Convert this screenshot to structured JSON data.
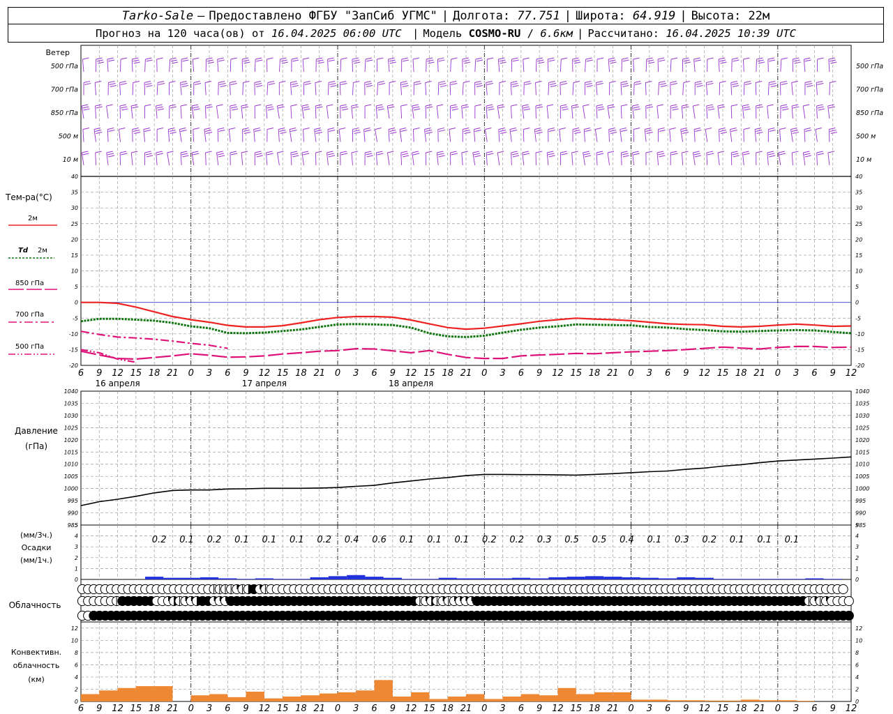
{
  "header": {
    "station": "Tarko-Sale",
    "provider": "Предоставлено ФГБУ \"ЗапСиб УГМС\"",
    "lon_label": "Долгота:",
    "lon": "77.751",
    "lat_label": "Широта:",
    "lat": "64.919",
    "alt_label": "Высота:",
    "alt": "22м",
    "forecast_label": "Прогноз на 120 часа(ов) от",
    "forecast_time": "16.04.2025 06:00 UTC",
    "model_label": "Модель",
    "model": "COSMO-RU",
    "resolution": "6.6км",
    "calc_label": "Рассчитано:",
    "calc_time": "16.04.2025 10:39 UTC"
  },
  "labels": {
    "wind": "Ветер",
    "temp": "Тем-ра(°С)",
    "t2m": "2м",
    "td": "Td",
    "td_level": "2м",
    "t850": "850 гПа",
    "t700": "700 гПа",
    "t500": "500 гПа",
    "pressure1": "Давление",
    "pressure2": "(гПа)",
    "precip1": "(мм/3ч.)",
    "precip2": "Осадки",
    "precip3": "(мм/1ч.)",
    "clouds": "Облачность",
    "conv1": "Конвективн.",
    "conv2": "облачность",
    "conv3": "(км)"
  },
  "chart_data": [
    {
      "type": "wind-barbs",
      "levels": [
        "500 гПа",
        "700 гПа",
        "850 гПа",
        "500 м",
        "10 м"
      ],
      "x_range_hours": [
        0,
        126
      ],
      "color": "#9933cc"
    },
    {
      "type": "line",
      "ylabel": "Тем-ра(°С)",
      "ylim": [
        -20,
        40
      ],
      "yticks": [
        -20,
        -15,
        -10,
        -5,
        0,
        5,
        10,
        15,
        20,
        25,
        30,
        35,
        40
      ],
      "x_hours": [
        0,
        3,
        6,
        9,
        12,
        15,
        18,
        21,
        24,
        27,
        30,
        33,
        36,
        39,
        42,
        45,
        48,
        51,
        54,
        57,
        60,
        63,
        66,
        69,
        72,
        75,
        78,
        81,
        84,
        87,
        90,
        93,
        96,
        99,
        102,
        105,
        108,
        111,
        114,
        117,
        120,
        123,
        126
      ],
      "xtick_labels": [
        "6",
        "9",
        "12",
        "15",
        "18",
        "21",
        "0",
        "3",
        "6",
        "9",
        "12",
        "15",
        "18",
        "21",
        "0",
        "3",
        "6",
        "9",
        "12",
        "15",
        "18",
        "21",
        "0",
        "3",
        "6",
        "9",
        "12",
        "15",
        "18",
        "21",
        "0",
        "3",
        "6",
        "9",
        "12",
        "15",
        "18",
        "21",
        "0",
        "3",
        "6",
        "9",
        "12"
      ],
      "day_labels": [
        {
          "hour": 6,
          "text": "16 апреля"
        },
        {
          "hour": 30,
          "text": "17 апреля"
        },
        {
          "hour": 54,
          "text": "18 апреля"
        }
      ],
      "series": [
        {
          "name": "2м",
          "color": "#ee2222",
          "dash": "solid",
          "x": [
            0,
            3,
            6,
            9,
            12,
            15,
            18,
            21,
            24,
            27,
            30,
            33,
            36,
            39,
            42,
            45,
            48,
            51,
            54,
            57,
            60,
            63,
            66,
            69,
            72,
            75,
            78,
            81,
            84,
            87,
            90,
            93,
            96,
            99,
            102,
            105,
            108,
            111,
            114,
            117,
            120,
            123,
            126
          ],
          "values": [
            0,
            0,
            -0.3,
            -1.5,
            -3,
            -4.5,
            -5.5,
            -6.3,
            -7.3,
            -7.8,
            -7.8,
            -7.4,
            -6.5,
            -5.5,
            -4.8,
            -4.5,
            -4.5,
            -4.7,
            -5.6,
            -6.8,
            -8,
            -8.5,
            -8.2,
            -7.5,
            -6.8,
            -6,
            -5.5,
            -5,
            -5.3,
            -5.5,
            -5.8,
            -6.3,
            -6.8,
            -7,
            -7.1,
            -7.6,
            -7.8,
            -7.6,
            -7.2,
            -6.9,
            -7.2,
            -7.6,
            -7.5
          ]
        },
        {
          "name": "Td 2м",
          "color": "#117711",
          "dash": "dotted",
          "x": [
            0,
            3,
            6,
            9,
            12,
            15,
            18,
            21,
            24,
            27,
            30,
            33,
            36,
            39,
            42,
            45,
            48,
            51,
            54,
            57,
            60,
            63,
            66,
            69,
            72,
            75,
            78,
            81,
            84,
            87,
            90,
            93,
            96,
            99,
            102,
            105,
            108,
            111,
            114,
            117,
            120,
            123,
            126
          ],
          "values": [
            -6,
            -5.2,
            -5.2,
            -5.5,
            -5.8,
            -6.5,
            -7.6,
            -8.2,
            -9.7,
            -9.8,
            -9.6,
            -9.1,
            -8.6,
            -7.8,
            -7,
            -6.9,
            -7,
            -7.2,
            -8,
            -9.8,
            -10.8,
            -11,
            -10.6,
            -9.6,
            -8.7,
            -8,
            -7.6,
            -7,
            -7.1,
            -7.2,
            -7.3,
            -7.8,
            -8,
            -8.5,
            -8.8,
            -9.2,
            -9.3,
            -9.1,
            -8.9,
            -8.8,
            -8.9,
            -9.4,
            -9.8
          ]
        },
        {
          "name": "850 гПа",
          "color": "#dd1177",
          "dash": "dashed",
          "x": [
            0,
            3,
            6,
            9,
            12,
            15,
            18,
            21,
            24,
            27,
            30,
            33,
            36,
            39,
            42,
            45,
            48,
            51,
            54,
            57,
            60,
            63,
            66,
            69,
            72,
            75,
            78,
            81,
            84,
            87,
            90,
            93,
            96,
            99,
            102,
            105,
            108,
            111,
            114,
            117,
            120,
            123,
            126
          ],
          "values": [
            -15.5,
            -16.7,
            -17.8,
            -18,
            -17.5,
            -17,
            -16.3,
            -16.8,
            -17.4,
            -17.3,
            -17,
            -16.4,
            -16,
            -15.5,
            -15.3,
            -14.7,
            -14.8,
            -15.4,
            -16,
            -15.3,
            -16.5,
            -17.5,
            -17.8,
            -17.8,
            -17,
            -16.7,
            -16.5,
            -16.2,
            -16.3,
            -16,
            -15.7,
            -15.5,
            -15.3,
            -15,
            -14.6,
            -14.2,
            -14.5,
            -14.8,
            -14.3,
            -14,
            -14,
            -14.3,
            -14.2
          ]
        },
        {
          "name": "700 гПа",
          "color": "#dd1177",
          "dash": "dashdot",
          "x": [
            0,
            3,
            6,
            9,
            12,
            15,
            18,
            21,
            24
          ],
          "values": [
            -9.2,
            -10.2,
            -11,
            -11.3,
            -11.7,
            -12.3,
            -13,
            -13.6,
            -14.6
          ]
        },
        {
          "name": "500 гПа",
          "color": "#dd1177",
          "dash": "dashdotdot",
          "x": [
            0,
            3,
            6,
            9
          ],
          "values": [
            -15,
            -16,
            -18,
            -19
          ]
        }
      ]
    },
    {
      "type": "line",
      "ylabel": "Давление (гПа)",
      "ylim": [
        985,
        1040
      ],
      "yticks": [
        985,
        990,
        995,
        1000,
        1005,
        1010,
        1015,
        1020,
        1025,
        1030,
        1035,
        1040
      ],
      "x": [
        0,
        3,
        6,
        9,
        12,
        15,
        18,
        21,
        24,
        27,
        30,
        33,
        36,
        39,
        42,
        45,
        48,
        51,
        54,
        57,
        60,
        63,
        66,
        69,
        72,
        75,
        78,
        81,
        84,
        87,
        90,
        93,
        96,
        99,
        102,
        105,
        108,
        111,
        114,
        117,
        120,
        123,
        126
      ],
      "values": [
        993,
        994.6,
        995.6,
        996.8,
        998.2,
        999.2,
        999.4,
        999.4,
        999.8,
        999.9,
        1000.1,
        1000.1,
        1000.1,
        1000.2,
        1000.4,
        1000.9,
        1001.3,
        1002.3,
        1003.1,
        1003.9,
        1004.5,
        1005.3,
        1005.8,
        1005.8,
        1005.7,
        1005.7,
        1005.6,
        1005.5,
        1005.8,
        1006.1,
        1006.5,
        1006.9,
        1007.2,
        1007.9,
        1008.4,
        1009.2,
        1009.8,
        1010.6,
        1011.3,
        1011.7,
        1012.1,
        1012.5,
        1013
      ]
    },
    {
      "type": "bar",
      "ylabel": "Осадки (мм/1ч.)",
      "ylim": [
        0,
        5
      ],
      "yticks": [
        0,
        1,
        2,
        3,
        4,
        5
      ],
      "color": "#2233dd",
      "x": [
        12,
        15,
        18,
        21,
        24,
        27,
        30,
        33,
        36,
        39,
        42,
        45,
        48,
        51,
        54,
        57,
        60,
        63,
        66,
        69,
        72,
        75,
        78,
        81,
        84,
        87,
        90,
        93,
        96,
        99,
        102,
        105,
        108,
        111,
        114,
        117,
        120,
        123
      ],
      "values": [
        0.25,
        0.15,
        0.15,
        0.2,
        0.1,
        0.05,
        0.1,
        0.05,
        0.05,
        0.2,
        0.3,
        0.4,
        0.25,
        0.15,
        0.05,
        0.05,
        0.15,
        0.1,
        0.1,
        0.1,
        0.15,
        0.1,
        0.2,
        0.25,
        0.3,
        0.25,
        0.2,
        0.15,
        0.1,
        0.2,
        0.15,
        0.05,
        0.05,
        0.05,
        0.05,
        0.05,
        0.1,
        0.05
      ],
      "sums_3h": [
        "0.2",
        "0.1",
        "0.2",
        "0.1",
        "0.1",
        "0.1",
        "0.2",
        "0.4",
        "0.6",
        "0.1",
        "0.1",
        "0.1",
        "0.2",
        "0.2",
        "0.3",
        "0.5",
        "0.5",
        "0.4",
        "0.1",
        "0.3",
        "0.2",
        "0.1",
        "0.1",
        "0.1"
      ]
    },
    {
      "type": "table",
      "title": "Облачность",
      "rows": [
        "high",
        "middle",
        "low"
      ],
      "hour_step": 2,
      "cover": [
        "00000000000000000000000111121342100000000000000000000000000000000000000000000000000000000000000000000000000000000000000000000000000000",
        "0000001444444002312234422244444444444444444444444444444444412312122224444444444444444444444444444444444444444444444444444444444121200000",
        "0044444444444444444444444444444444444444444444444444444444444444444444444444444444444444444444444444444444444444444444444444444444444444"
      ]
    },
    {
      "type": "bar",
      "ylabel": "Конвективн. облачность (км)",
      "ylim": [
        0,
        13
      ],
      "yticks": [
        0,
        2,
        4,
        6,
        8,
        10,
        12
      ],
      "color": "#ee8833",
      "x": [
        0,
        3,
        6,
        9,
        12,
        15,
        18,
        21,
        24,
        27,
        30,
        33,
        36,
        39,
        42,
        45,
        48,
        51,
        54,
        57,
        60,
        63,
        66,
        69,
        72,
        75,
        78,
        81,
        84,
        87,
        90,
        93,
        96,
        99,
        102,
        105,
        108,
        111,
        114,
        117,
        120
      ],
      "values": [
        1.2,
        1.8,
        2.2,
        2.5,
        2.5,
        0,
        1.0,
        1.2,
        0.7,
        1.6,
        0.5,
        0.8,
        1.0,
        1.3,
        1.5,
        1.8,
        3.5,
        0.8,
        1.5,
        0.4,
        0.8,
        1.2,
        0.4,
        0.8,
        1.2,
        1.0,
        2.2,
        1.2,
        1.5,
        1.5,
        0.3,
        0.3,
        0.2,
        0.2,
        0.15,
        0.15,
        0.3,
        0.2,
        0.2,
        0.1,
        0
      ]
    }
  ]
}
